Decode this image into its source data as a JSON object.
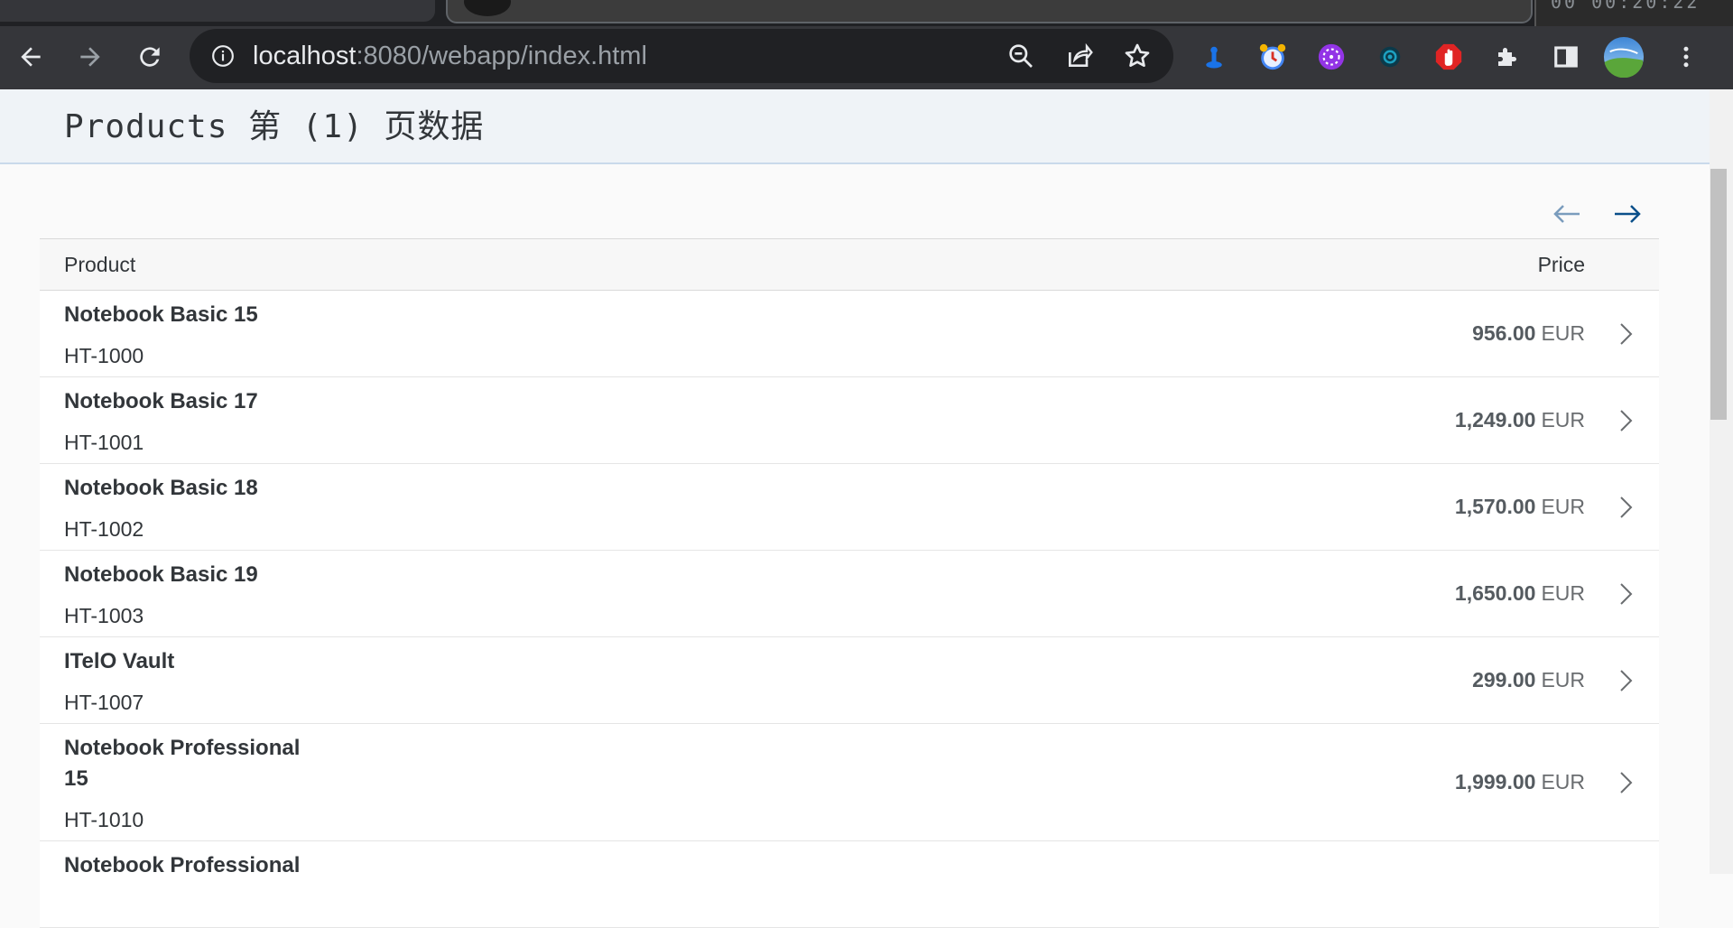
{
  "browser": {
    "url_host": "localhost",
    "url_rest": ":8080/webapp/index.html",
    "back_icon": "arrow-left-icon",
    "forward_icon": "arrow-right-icon",
    "reload_icon": "reload-icon",
    "clock_text": "00 00:20:22",
    "extensions": [
      "tampermonkey-icon",
      "alarm-clock-icon",
      "devtools-extension-icon",
      "vue-devtools-icon",
      "adblock-icon",
      "puzzle-icon",
      "side-panel-icon",
      "profile-avatar-icon",
      "more-menu-icon"
    ]
  },
  "page": {
    "title": "Products 第 (1) 页数据"
  },
  "pager": {
    "prev_icon": "arrow-left-icon",
    "next_icon": "arrow-right-icon"
  },
  "table": {
    "columns": {
      "product": "Product",
      "price": "Price"
    },
    "rows": [
      {
        "name": "Notebook Basic 15",
        "id": "HT-1000",
        "price": "956.00",
        "currency": "EUR"
      },
      {
        "name": "Notebook Basic 17",
        "id": "HT-1001",
        "price": "1,249.00",
        "currency": "EUR"
      },
      {
        "name": "Notebook Basic 18",
        "id": "HT-1002",
        "price": "1,570.00",
        "currency": "EUR"
      },
      {
        "name": "Notebook Basic 19",
        "id": "HT-1003",
        "price": "1,650.00",
        "currency": "EUR"
      },
      {
        "name": "ITelO Vault",
        "id": "HT-1007",
        "price": "299.00",
        "currency": "EUR"
      },
      {
        "name": "Notebook Professional 15",
        "id": "HT-1010",
        "price": "1,999.00",
        "currency": "EUR"
      },
      {
        "name": "Notebook Professional",
        "id": "",
        "price": "",
        "currency": ""
      }
    ]
  },
  "colors": {
    "header_bg": "#eff3f7",
    "pager_active": "#0a4f8a",
    "pager_inactive": "#7a9cbd"
  }
}
